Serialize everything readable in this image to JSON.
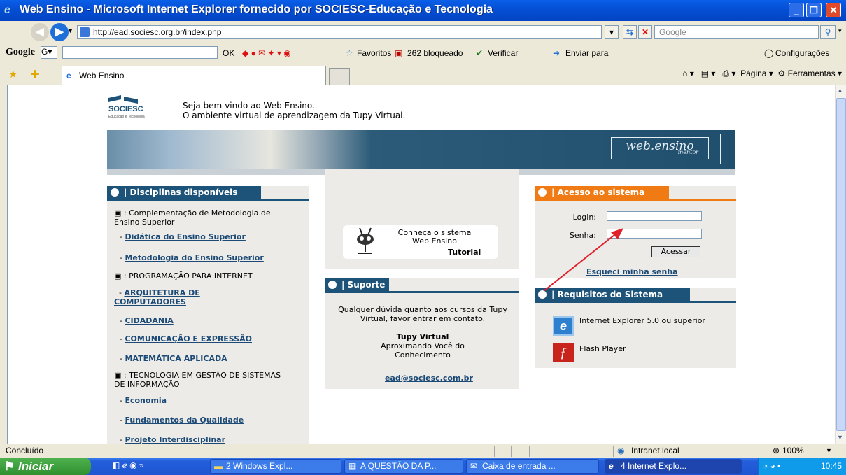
{
  "window": {
    "title": "Web Ensino - Microsoft Internet Explorer fornecido por SOCIESC-Educação e Tecnologia"
  },
  "toolbar": {
    "url": "http://ead.sociesc.org.br/index.php",
    "search_placeholder": "Google"
  },
  "google_toolbar": {
    "logo": "Google",
    "ok": "OK",
    "favorites": "Favoritos",
    "blocked": "262 bloqueado",
    "check": "Verificar",
    "send": "Enviar para",
    "settings": "Configurações"
  },
  "tab": {
    "label": "Web Ensino"
  },
  "commandbar": {
    "page": "Página",
    "tools": "Ferramentas"
  },
  "page": {
    "logo_text": "SOCIESC",
    "logo_sub": "Educação e Tecnologia",
    "greeting1": "Seja bem-vindo ao Web Ensino.",
    "greeting2": "O ambiente virtual de aprendizagem da Tupy Virtual.",
    "banner_mark": "web.ensino",
    "banner_sub": "mentor",
    "disciplinas": {
      "header": "| Disciplinas disponíveis",
      "cat1": "▣ : Complementação de Metodologia de Ensino Superior",
      "link1": "Didática do Ensino Superior",
      "link2": "Metodologia do Ensino Superior",
      "cat2": "▣ : PROGRAMAÇÃO PARA INTERNET",
      "link3": "ARQUITETURA DE COMPUTADORES",
      "link4": "CIDADANIA",
      "link5": "COMUNICAÇÃO E EXPRESSÃO",
      "link6": "MATEMÁTICA APLICADA",
      "cat3": "▣ : TECNOLOGIA EM GESTÃO DE SISTEMAS DE INFORMAÇÃO",
      "link7": "Economia",
      "link8": "Fundamentos da Qualidade",
      "link9": "Projeto Interdisciplinar"
    },
    "tutorial": {
      "line1": "Conheça o sistema",
      "line2": "Web Ensino",
      "label": "Tutorial"
    },
    "suporte": {
      "header": "| Suporte",
      "text": "Qualquer dúvida quanto aos cursos da Tupy Virtual, favor entrar em contato.",
      "brand": "Tupy Virtual",
      "slogan": "Aproximando Você do Conhecimento",
      "email": "ead@sociesc.com.br"
    },
    "acesso": {
      "header": "| Acesso ao sistema",
      "login_label": "Login:",
      "senha_label": "Senha:",
      "button": "Acessar",
      "forgot": "Esqueci minha senha"
    },
    "requisitos": {
      "header": "| Requisitos do Sistema",
      "ie": "Internet Explorer 5.0 ou superior",
      "flash": "Flash Player"
    }
  },
  "statusbar": {
    "text": "Concluído",
    "zone": "Intranet local",
    "zoom": "100%"
  },
  "taskbar": {
    "start": "Iniciar",
    "t1": "2 Windows Expl...",
    "t2": "A QUESTÃO DA P...",
    "t3": "Caixa de entrada ...",
    "t4": "4 Internet Explo...",
    "time": "10:45"
  },
  "colors": {
    "accent_blue": "#1d5379",
    "accent_orange": "#f07b15",
    "link": "#1c4a76",
    "arrow": "#e0202a"
  }
}
